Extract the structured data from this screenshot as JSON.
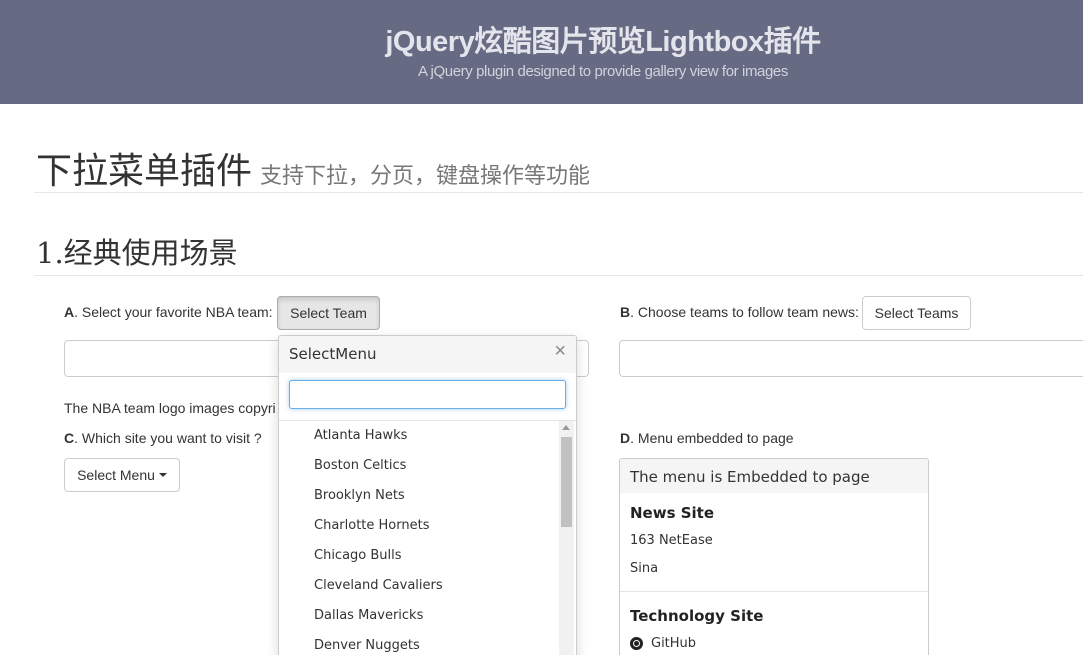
{
  "banner": {
    "title": "jQuery炫酷图片预览Lightbox插件",
    "subtitle": "A jQuery plugin designed to provide gallery view for images"
  },
  "page": {
    "heading": "下拉菜单插件",
    "heading_small": "支持下拉，分页，键盘操作等功能",
    "section_title": "1.经典使用场景"
  },
  "section_a": {
    "letter": "A",
    "label": ". Select your favorite NBA team:",
    "button": "Select Team"
  },
  "section_b": {
    "letter": "B",
    "label": ". Choose teams to follow team news:",
    "button": "Select Teams"
  },
  "section_c": {
    "letter": "C",
    "label": ". Which site you want to visit ?",
    "button": "Select Menu"
  },
  "section_d": {
    "letter": "D",
    "label": ". Menu embedded to page"
  },
  "note": "The NBA team logo images copyri",
  "popup": {
    "title": "SelectMenu",
    "close": "×",
    "search_value": "",
    "items": [
      "Atlanta Hawks",
      "Boston Celtics",
      "Brooklyn Nets",
      "Charlotte Hornets",
      "Chicago Bulls",
      "Cleveland Cavaliers",
      "Dallas Mavericks",
      "Denver Nuggets"
    ]
  },
  "embedded": {
    "header": "The menu is Embedded to page",
    "group1_title": "News Site",
    "group1_items": [
      "163 NetEase",
      "Sina"
    ],
    "group2_title": "Technology Site",
    "group2_items": [
      "GitHub"
    ]
  },
  "colors": {
    "banner_bg": "#666a82",
    "focus_border": "#66afe9"
  }
}
